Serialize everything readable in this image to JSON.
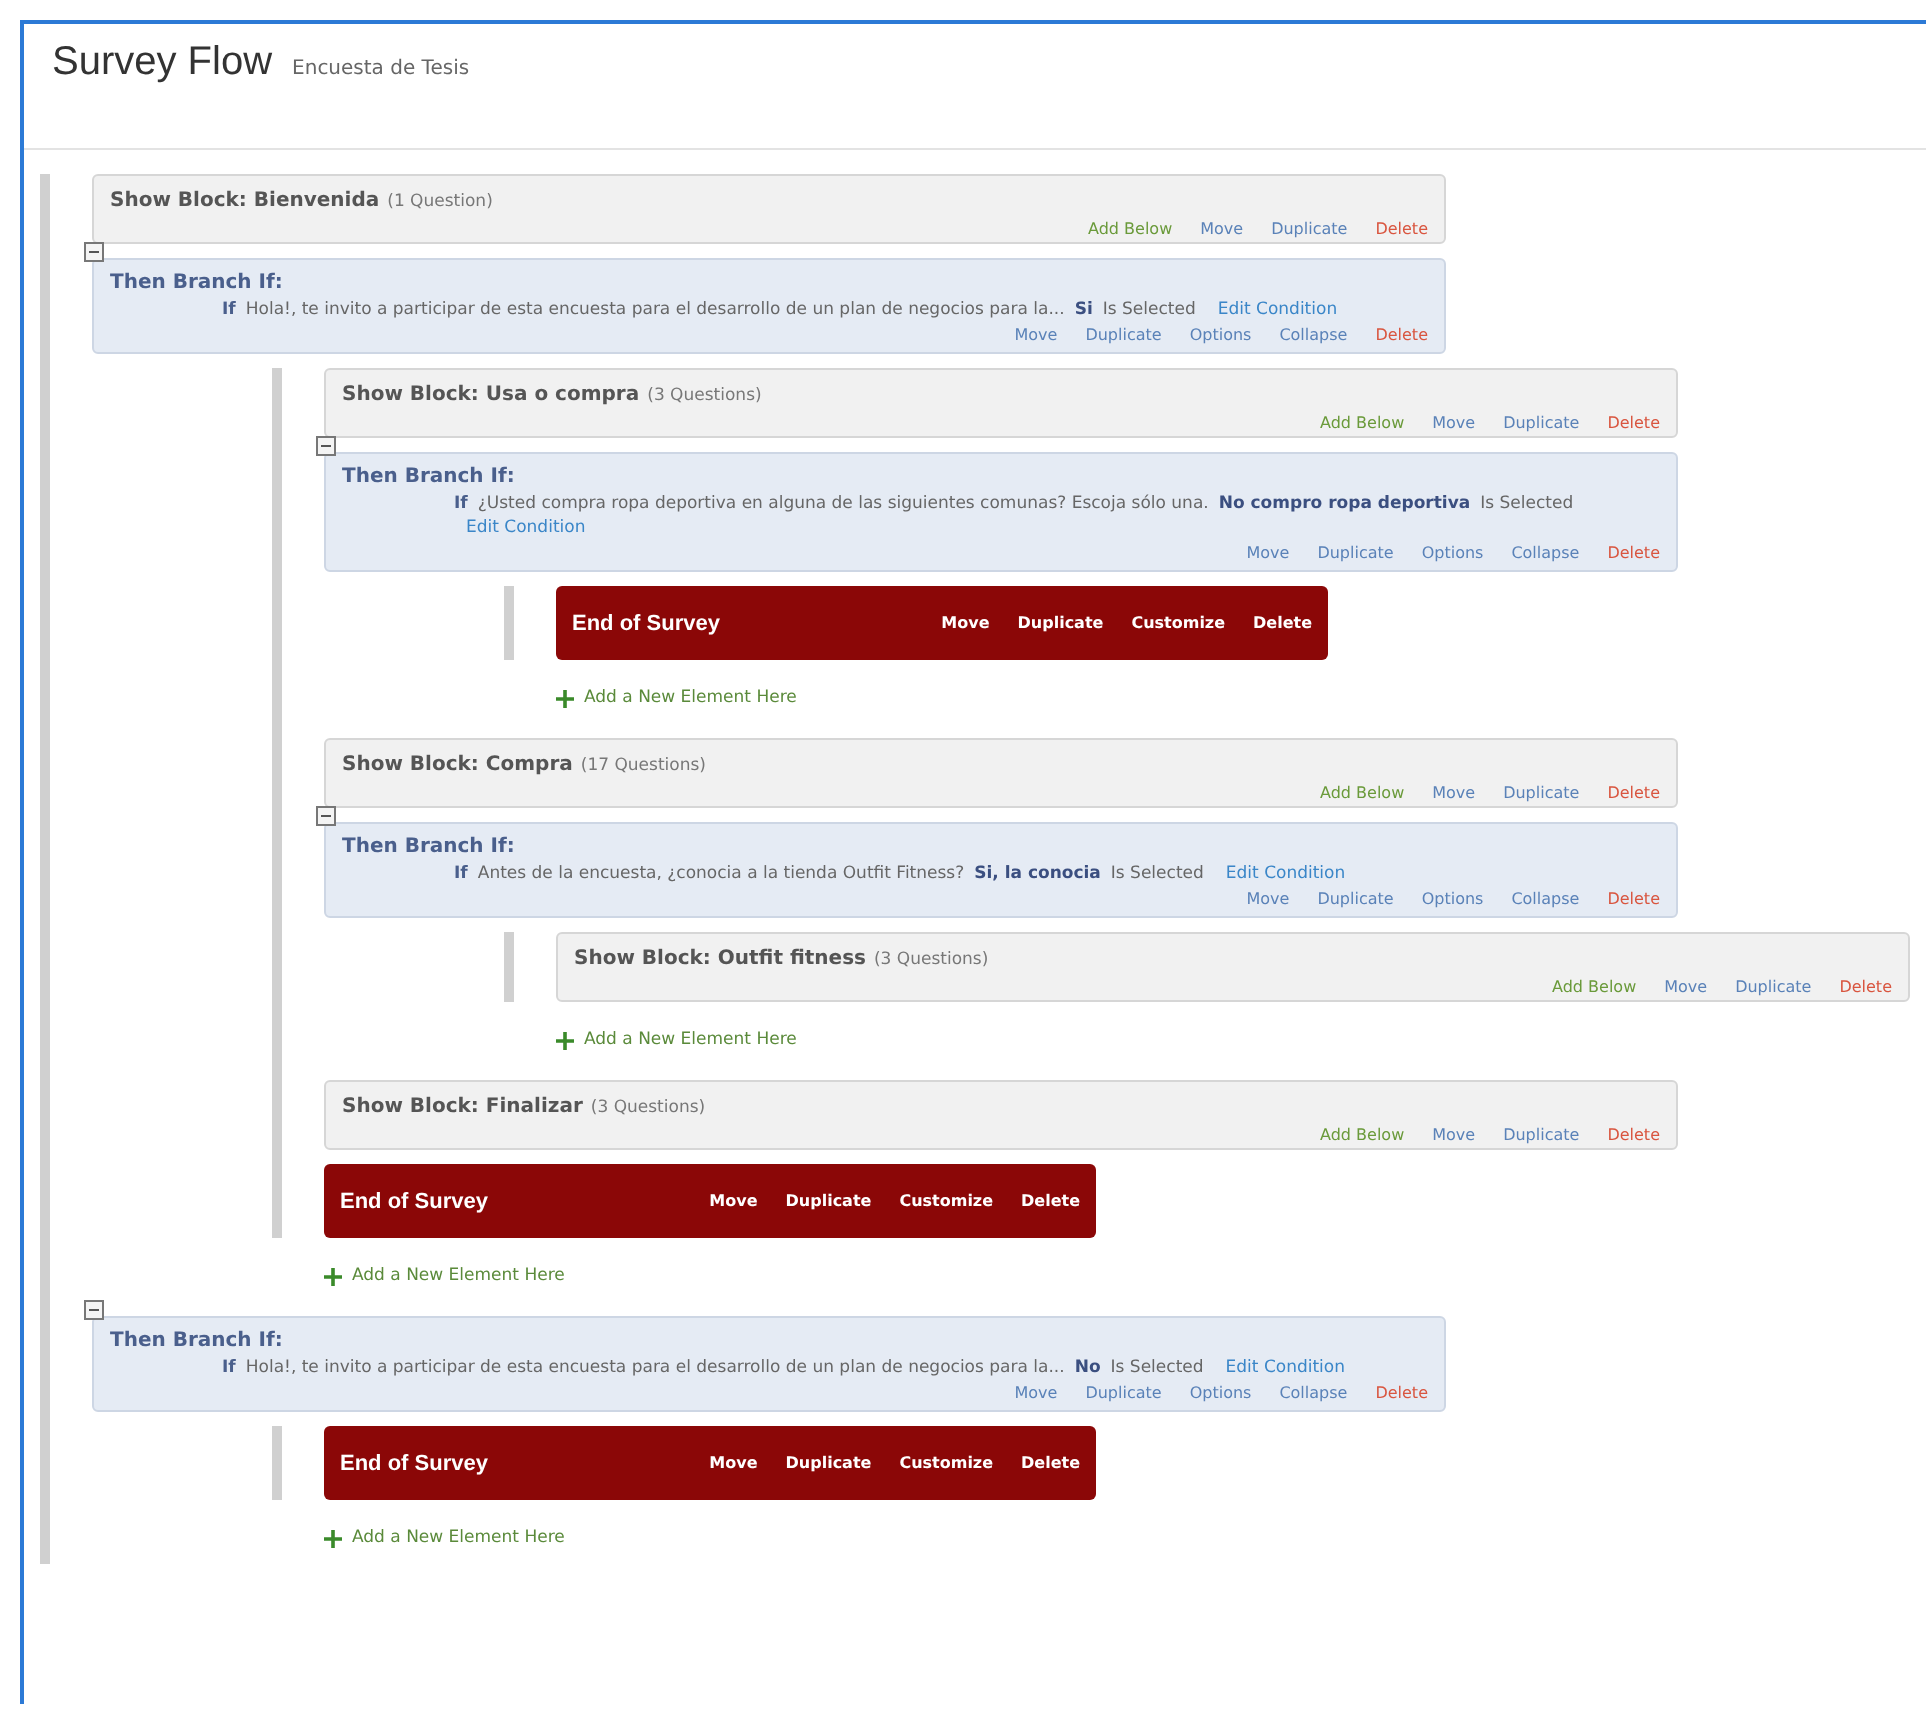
{
  "header": {
    "title": "Survey Flow",
    "subtitle": "Encuesta de Tesis"
  },
  "flow": [
    {
      "kind": "block",
      "prefix": "Show Block:",
      "name": "Bienvenida",
      "count": "(1 Question)",
      "actions": [
        {
          "label": "Add Below",
          "kind": "add"
        },
        {
          "label": "Move",
          "kind": "normal"
        },
        {
          "label": "Duplicate",
          "kind": "normal"
        },
        {
          "label": "Delete",
          "kind": "delete"
        }
      ]
    },
    {
      "kind": "branch",
      "expanded": true,
      "title": "Then Branch If:",
      "if": "If",
      "question": "Hola!, te invito a participar de esta encuesta para el desarrollo de un plan de negocios para la...",
      "answer": "Si",
      "operator": "Is Selected",
      "edit": "Edit Condition",
      "actions": [
        {
          "label": "Move",
          "kind": "normal"
        },
        {
          "label": "Duplicate",
          "kind": "normal"
        },
        {
          "label": "Options",
          "kind": "normal"
        },
        {
          "label": "Collapse",
          "kind": "normal"
        },
        {
          "label": "Delete",
          "kind": "delete"
        }
      ],
      "add_label": "Add a New Element Here",
      "children": [
        {
          "kind": "block",
          "prefix": "Show Block:",
          "name": "Usa o compra",
          "count": "(3 Questions)",
          "actions": [
            {
              "label": "Add Below",
              "kind": "add"
            },
            {
              "label": "Move",
              "kind": "normal"
            },
            {
              "label": "Duplicate",
              "kind": "normal"
            },
            {
              "label": "Delete",
              "kind": "delete"
            }
          ]
        },
        {
          "kind": "branch",
          "expanded": true,
          "title": "Then Branch If:",
          "if": "If",
          "question": "¿Usted compra ropa deportiva en alguna de las siguientes comunas? Escoja sólo una.",
          "answer": "No compro ropa deportiva",
          "operator": "Is Selected",
          "edit": "Edit Condition",
          "actions": [
            {
              "label": "Move",
              "kind": "normal"
            },
            {
              "label": "Duplicate",
              "kind": "normal"
            },
            {
              "label": "Options",
              "kind": "normal"
            },
            {
              "label": "Collapse",
              "kind": "normal"
            },
            {
              "label": "Delete",
              "kind": "delete"
            }
          ],
          "add_label": "Add a New Element Here",
          "children": [
            {
              "kind": "end",
              "title": "End of Survey",
              "actions": [
                {
                  "label": "Move",
                  "kind": "normal"
                },
                {
                  "label": "Duplicate",
                  "kind": "normal"
                },
                {
                  "label": "Customize",
                  "kind": "normal"
                },
                {
                  "label": "Delete",
                  "kind": "normal"
                }
              ]
            }
          ]
        },
        {
          "kind": "block",
          "prefix": "Show Block:",
          "name": "Compra",
          "count": "(17 Questions)",
          "actions": [
            {
              "label": "Add Below",
              "kind": "add"
            },
            {
              "label": "Move",
              "kind": "normal"
            },
            {
              "label": "Duplicate",
              "kind": "normal"
            },
            {
              "label": "Delete",
              "kind": "delete"
            }
          ]
        },
        {
          "kind": "branch",
          "expanded": true,
          "title": "Then Branch If:",
          "if": "If",
          "question": "Antes de la encuesta, ¿conocia a la tienda Outfit Fitness?",
          "answer": "Si, la conocia",
          "operator": "Is Selected",
          "edit": "Edit Condition",
          "actions": [
            {
              "label": "Move",
              "kind": "normal"
            },
            {
              "label": "Duplicate",
              "kind": "normal"
            },
            {
              "label": "Options",
              "kind": "normal"
            },
            {
              "label": "Collapse",
              "kind": "normal"
            },
            {
              "label": "Delete",
              "kind": "delete"
            }
          ],
          "add_label": "Add a New Element Here",
          "children": [
            {
              "kind": "block",
              "prefix": "Show Block:",
              "name": "Outfit fitness",
              "count": "(3 Questions)",
              "actions": [
                {
                  "label": "Add Below",
                  "kind": "add"
                },
                {
                  "label": "Move",
                  "kind": "normal"
                },
                {
                  "label": "Duplicate",
                  "kind": "normal"
                },
                {
                  "label": "Delete",
                  "kind": "delete"
                }
              ]
            }
          ]
        },
        {
          "kind": "block",
          "prefix": "Show Block:",
          "name": "Finalizar",
          "count": "(3 Questions)",
          "actions": [
            {
              "label": "Add Below",
              "kind": "add"
            },
            {
              "label": "Move",
              "kind": "normal"
            },
            {
              "label": "Duplicate",
              "kind": "normal"
            },
            {
              "label": "Delete",
              "kind": "delete"
            }
          ]
        },
        {
          "kind": "end",
          "title": "End of Survey",
          "actions": [
            {
              "label": "Move",
              "kind": "normal"
            },
            {
              "label": "Duplicate",
              "kind": "normal"
            },
            {
              "label": "Customize",
              "kind": "normal"
            },
            {
              "label": "Delete",
              "kind": "normal"
            }
          ]
        }
      ]
    },
    {
      "kind": "branch",
      "expanded": true,
      "title": "Then Branch If:",
      "if": "If",
      "question": "Hola!, te invito a participar de esta encuesta para el desarrollo de un plan de negocios para la...",
      "answer": "No",
      "operator": "Is Selected",
      "edit": "Edit Condition",
      "actions": [
        {
          "label": "Move",
          "kind": "normal"
        },
        {
          "label": "Duplicate",
          "kind": "normal"
        },
        {
          "label": "Options",
          "kind": "normal"
        },
        {
          "label": "Collapse",
          "kind": "normal"
        },
        {
          "label": "Delete",
          "kind": "delete"
        }
      ],
      "add_label": "Add a New Element Here",
      "children": [
        {
          "kind": "end",
          "title": "End of Survey",
          "actions": [
            {
              "label": "Move",
              "kind": "normal"
            },
            {
              "label": "Duplicate",
              "kind": "normal"
            },
            {
              "label": "Customize",
              "kind": "normal"
            },
            {
              "label": "Delete",
              "kind": "normal"
            }
          ]
        }
      ]
    }
  ]
}
